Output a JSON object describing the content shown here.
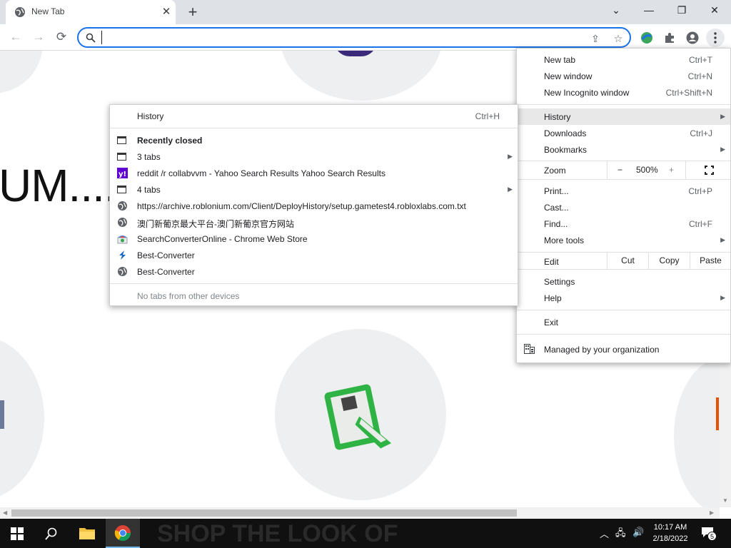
{
  "browser": {
    "tab": {
      "title": "New Tab",
      "close": "✕"
    },
    "new_tab_symbol": "+",
    "window_controls": {
      "tabsearch": "⌄",
      "minimize": "—",
      "restore": "❐",
      "close": "✕"
    },
    "toolbar": {
      "back": "←",
      "forward": "→",
      "reload": "⟳"
    },
    "omnibox": {
      "value": "",
      "placeholder": ""
    }
  },
  "page": {
    "banner_text": "UM....",
    "taskbar_bg_text": "SHOP THE LOOK OF"
  },
  "main_menu": {
    "items": [
      {
        "label": "New tab",
        "shortcut": "Ctrl+T"
      },
      {
        "label": "New window",
        "shortcut": "Ctrl+N"
      },
      {
        "label": "New Incognito window",
        "shortcut": "Ctrl+Shift+N"
      },
      {
        "label": "History",
        "shortcut": ""
      },
      {
        "label": "Downloads",
        "shortcut": "Ctrl+J"
      },
      {
        "label": "Bookmarks",
        "shortcut": ""
      },
      {
        "label": "Print...",
        "shortcut": "Ctrl+P"
      },
      {
        "label": "Cast...",
        "shortcut": ""
      },
      {
        "label": "Find...",
        "shortcut": "Ctrl+F"
      },
      {
        "label": "More tools",
        "shortcut": ""
      },
      {
        "label": "Settings",
        "shortcut": ""
      },
      {
        "label": "Help",
        "shortcut": ""
      },
      {
        "label": "Exit",
        "shortcut": ""
      }
    ],
    "zoom": {
      "label": "Zoom",
      "minus": "−",
      "value": "500%",
      "plus": "+"
    },
    "edit": {
      "label": "Edit",
      "cut": "Cut",
      "copy": "Copy",
      "paste": "Paste"
    },
    "managed": "Managed by your organization"
  },
  "history_menu": {
    "history": {
      "label": "History",
      "shortcut": "Ctrl+H"
    },
    "recently_closed_label": "Recently closed",
    "entries": [
      {
        "label": "3 tabs",
        "icon": "tab-group-icon"
      },
      {
        "label": "reddit /r collabvvm - Yahoo Search Results Yahoo Search Results",
        "icon": "yahoo-icon"
      },
      {
        "label": "4 tabs",
        "icon": "tab-group-icon"
      },
      {
        "label": "https://archive.roblonium.com/Client/DeployHistory/setup.gametest4.robloxlabs.com.txt",
        "icon": "globe-icon"
      },
      {
        "label": "澳门新葡京最大平台-澳门新葡京官方网站",
        "icon": "globe-icon"
      },
      {
        "label": "SearchConverterOnline - Chrome Web Store",
        "icon": "webstore-icon"
      },
      {
        "label": "Best-Converter",
        "icon": "converter-icon"
      },
      {
        "label": "Best-Converter",
        "icon": "globe-icon"
      }
    ],
    "no_other_devices": "No tabs from other devices"
  },
  "taskbar": {
    "time": "10:17 AM",
    "date": "2/18/2022",
    "notifications": "5"
  },
  "colors": {
    "accent": "#1a73e8",
    "tabstrip": "#dee1e6",
    "yahoo": "#6001d2",
    "roblox_green": "#2fb344"
  }
}
